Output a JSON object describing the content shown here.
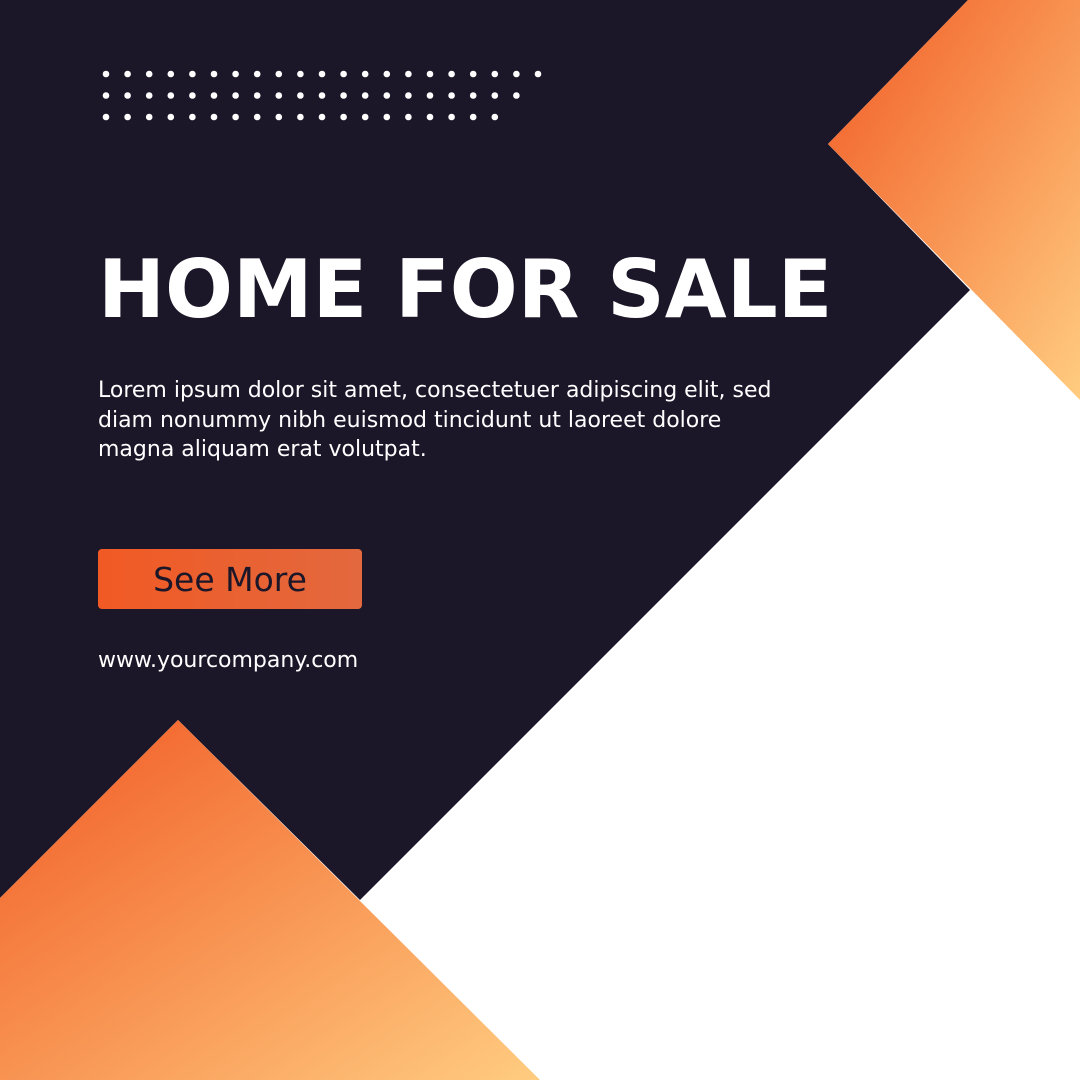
{
  "colors": {
    "background_white": "#FFFFFF",
    "dark_navy": "#1B1628",
    "accent_orange": "#F15A24",
    "accent_light": "#FFCC80",
    "dots": "#FFFFFF"
  },
  "decoration": {
    "dot_rows": [
      21,
      20,
      19
    ]
  },
  "headline": "HOME FOR SALE",
  "description": "Lorem ipsum dolor sit amet, consectetuer adipiscing elit, sed diam nonummy nibh euismod tincidunt ut laoreet dolore magna aliquam erat volutpat.",
  "cta": {
    "label": "See More"
  },
  "website": "www.yourcompany.com"
}
